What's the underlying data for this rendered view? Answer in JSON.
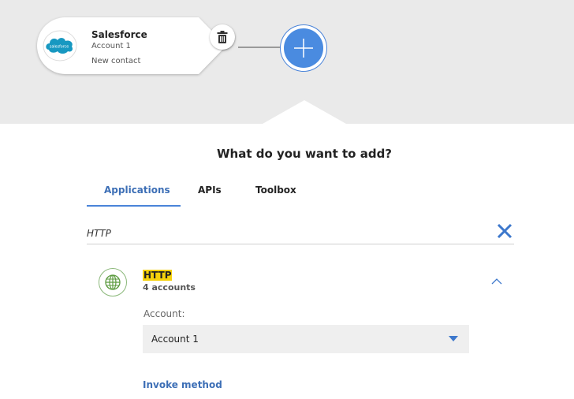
{
  "flow": {
    "node": {
      "app_name": "Salesforce",
      "account": "Account 1",
      "event": "New contact",
      "logo_text": "salesforce",
      "icons": {
        "delete": "trash-icon",
        "logo": "salesforce-cloud-icon"
      }
    },
    "add_button": {
      "icon": "plus-icon"
    }
  },
  "panel": {
    "heading": "What do you want to add?",
    "tabs": [
      {
        "label": "Applications",
        "selected": true
      },
      {
        "label": "APIs",
        "selected": false
      },
      {
        "label": "Toolbox",
        "selected": false
      }
    ],
    "search": {
      "value": "HTTP",
      "clear_icon": "close-icon"
    },
    "result": {
      "name": "HTTP",
      "accounts_count": "4 accounts",
      "icon": "globe-icon",
      "expanded": true,
      "account_label": "Account:",
      "account_selected": "Account 1",
      "action": "Invoke method"
    }
  },
  "colors": {
    "accent": "#4a84d9",
    "highlight": "#f5d10c",
    "canvas_bg": "#eaeaea",
    "salesforce_blue": "#1798c1",
    "http_green": "#5a9a3d"
  }
}
